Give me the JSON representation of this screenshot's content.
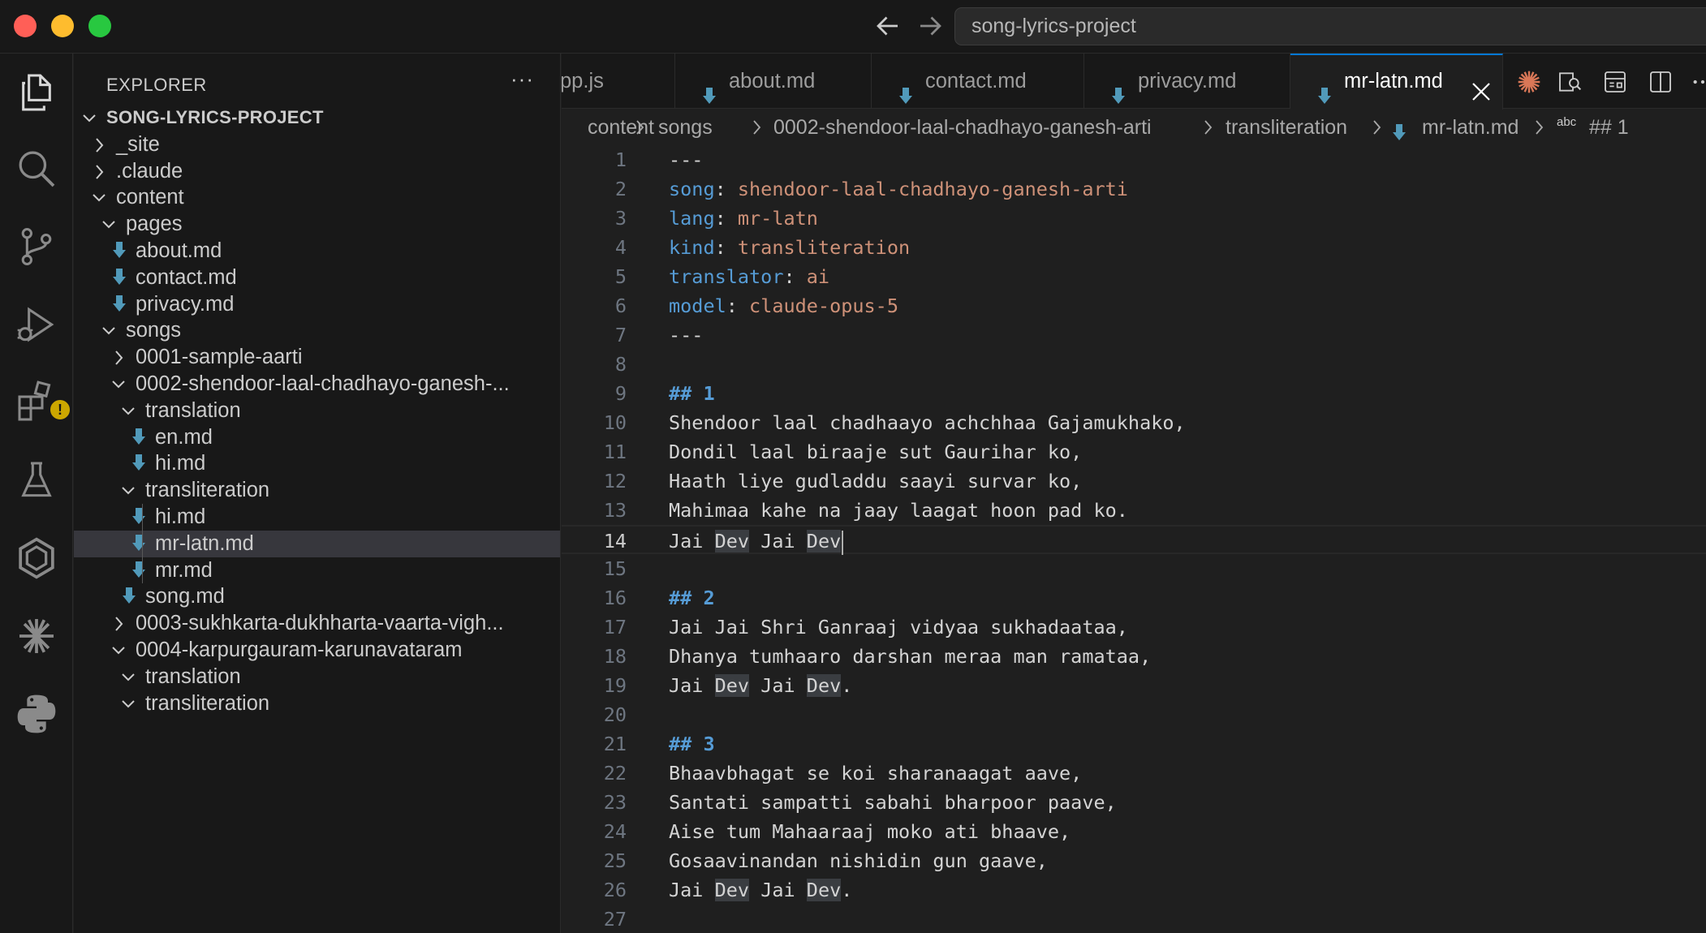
{
  "window": {
    "search_text": "song-lyrics-project"
  },
  "sidebar": {
    "title": "EXPLORER",
    "more": "···",
    "tree": [
      {
        "label": "SONG-LYRICS-PROJECT",
        "type": "root",
        "expanded": true,
        "depth": 0
      },
      {
        "label": "_site",
        "type": "folder",
        "expanded": false,
        "depth": 1
      },
      {
        "label": ".claude",
        "type": "folder",
        "expanded": false,
        "depth": 1
      },
      {
        "label": "content",
        "type": "folder",
        "expanded": true,
        "depth": 1
      },
      {
        "label": "pages",
        "type": "folder",
        "expanded": true,
        "depth": 2
      },
      {
        "label": "about.md",
        "type": "file",
        "depth": 3
      },
      {
        "label": "contact.md",
        "type": "file",
        "depth": 3
      },
      {
        "label": "privacy.md",
        "type": "file",
        "depth": 3
      },
      {
        "label": "songs",
        "type": "folder",
        "expanded": true,
        "depth": 2
      },
      {
        "label": "0001-sample-aarti",
        "type": "folder",
        "expanded": false,
        "depth": 3
      },
      {
        "label": "0002-shendoor-laal-chadhayo-ganesh-...",
        "type": "folder",
        "expanded": true,
        "depth": 3
      },
      {
        "label": "translation",
        "type": "folder",
        "expanded": true,
        "depth": 4
      },
      {
        "label": "en.md",
        "type": "file",
        "depth": 5
      },
      {
        "label": "hi.md",
        "type": "file",
        "depth": 5
      },
      {
        "label": "transliteration",
        "type": "folder",
        "expanded": true,
        "depth": 4
      },
      {
        "label": "hi.md",
        "type": "file",
        "depth": 5
      },
      {
        "label": "mr-latn.md",
        "type": "file",
        "depth": 5,
        "selected": true
      },
      {
        "label": "mr.md",
        "type": "file",
        "depth": 5
      },
      {
        "label": "song.md",
        "type": "file",
        "depth": 4
      },
      {
        "label": "0003-sukhkarta-dukhharta-vaarta-vigh...",
        "type": "folder",
        "expanded": false,
        "depth": 3
      },
      {
        "label": "0004-karpurgauram-karunavataram",
        "type": "folder",
        "expanded": true,
        "depth": 3
      },
      {
        "label": "translation",
        "type": "folder",
        "expanded": true,
        "depth": 4
      },
      {
        "label": "transliteration",
        "type": "folder",
        "expanded": true,
        "depth": 4
      }
    ]
  },
  "tabs": [
    {
      "label": "pp.js",
      "icon": false,
      "active": false
    },
    {
      "label": "about.md",
      "icon": true,
      "active": false
    },
    {
      "label": "contact.md",
      "icon": true,
      "active": false
    },
    {
      "label": "privacy.md",
      "icon": true,
      "active": false
    },
    {
      "label": "mr-latn.md",
      "icon": true,
      "active": true
    }
  ],
  "tab_actions": [
    "claude-icon",
    "open-preview-icon",
    "layout-icon",
    "split-editor-icon",
    "more-actions-icon"
  ],
  "breadcrumb": [
    "content",
    "songs",
    "0002-shendoor-laal-chadhayo-ganesh-arti",
    "transliteration",
    "mr-latn.md",
    "## 1"
  ],
  "breadcrumb_symbol_prefix": "abc",
  "editor": {
    "current_line": 14,
    "lines": [
      {
        "n": "1",
        "segs": [
          {
            "t": "---",
            "c": "p"
          }
        ]
      },
      {
        "n": "2",
        "segs": [
          {
            "t": "song",
            "c": "k"
          },
          {
            "t": ": ",
            "c": "p"
          },
          {
            "t": "shendoor-laal-chadhayo-ganesh-arti",
            "c": "v"
          }
        ]
      },
      {
        "n": "3",
        "segs": [
          {
            "t": "lang",
            "c": "k"
          },
          {
            "t": ": ",
            "c": "p"
          },
          {
            "t": "mr-latn",
            "c": "v"
          }
        ]
      },
      {
        "n": "4",
        "segs": [
          {
            "t": "kind",
            "c": "k"
          },
          {
            "t": ": ",
            "c": "p"
          },
          {
            "t": "transliteration",
            "c": "v"
          }
        ]
      },
      {
        "n": "5",
        "segs": [
          {
            "t": "translator",
            "c": "k"
          },
          {
            "t": ": ",
            "c": "p"
          },
          {
            "t": "ai",
            "c": "v"
          }
        ]
      },
      {
        "n": "6",
        "segs": [
          {
            "t": "model",
            "c": "k"
          },
          {
            "t": ": ",
            "c": "p"
          },
          {
            "t": "claude-opus-5",
            "c": "v"
          }
        ]
      },
      {
        "n": "7",
        "segs": [
          {
            "t": "---",
            "c": "p"
          }
        ]
      },
      {
        "n": "8",
        "segs": []
      },
      {
        "n": "9",
        "segs": [
          {
            "t": "## 1",
            "c": "h"
          }
        ]
      },
      {
        "n": "10",
        "segs": [
          {
            "t": "Shendoor laal chadhaayo achchhaa Gajamukhako,",
            "c": "p"
          }
        ]
      },
      {
        "n": "11",
        "segs": [
          {
            "t": "Dondil laal biraaje sut Gaurihar ko,",
            "c": "p"
          }
        ]
      },
      {
        "n": "12",
        "segs": [
          {
            "t": "Haath liye gudladdu saayi survar ko,",
            "c": "p"
          }
        ]
      },
      {
        "n": "13",
        "segs": [
          {
            "t": "Mahimaa kahe na jaay laagat hoon pad ko.",
            "c": "p"
          }
        ]
      },
      {
        "n": "14",
        "segs": [
          {
            "t": "Jai ",
            "c": "p"
          },
          {
            "t": "Dev",
            "c": "p hl"
          },
          {
            "t": " Jai ",
            "c": "p"
          },
          {
            "t": "Dev",
            "c": "p hl"
          }
        ],
        "caret": true
      },
      {
        "n": "15",
        "segs": []
      },
      {
        "n": "16",
        "segs": [
          {
            "t": "## 2",
            "c": "h"
          }
        ]
      },
      {
        "n": "17",
        "segs": [
          {
            "t": "Jai Jai Shri Ganraaj vidyaa sukhadaataa,",
            "c": "p"
          }
        ]
      },
      {
        "n": "18",
        "segs": [
          {
            "t": "Dhanya tumhaaro darshan meraa man ramataa,",
            "c": "p"
          }
        ]
      },
      {
        "n": "19",
        "segs": [
          {
            "t": "Jai ",
            "c": "p"
          },
          {
            "t": "Dev",
            "c": "p hl"
          },
          {
            "t": " Jai ",
            "c": "p"
          },
          {
            "t": "Dev",
            "c": "p hl"
          },
          {
            "t": ".",
            "c": "p"
          }
        ]
      },
      {
        "n": "20",
        "segs": []
      },
      {
        "n": "21",
        "segs": [
          {
            "t": "## 3",
            "c": "h"
          }
        ]
      },
      {
        "n": "22",
        "segs": [
          {
            "t": "Bhaavbhagat se koi sharanaagat aave,",
            "c": "p"
          }
        ]
      },
      {
        "n": "23",
        "segs": [
          {
            "t": "Santati sampatti sabahi bharpoor paave,",
            "c": "p"
          }
        ]
      },
      {
        "n": "24",
        "segs": [
          {
            "t": "Aise tum Mahaaraaj moko ati bhaave,",
            "c": "p"
          }
        ]
      },
      {
        "n": "25",
        "segs": [
          {
            "t": "Gosaavinandan nishidin gun gaave,",
            "c": "p"
          }
        ]
      },
      {
        "n": "26",
        "segs": [
          {
            "t": "Jai ",
            "c": "p"
          },
          {
            "t": "Dev",
            "c": "p hl"
          },
          {
            "t": " Jai ",
            "c": "p"
          },
          {
            "t": "Dev",
            "c": "p hl"
          },
          {
            "t": ".",
            "c": "p"
          }
        ]
      },
      {
        "n": "27",
        "segs": []
      }
    ]
  },
  "activity_bar": [
    "explorer-icon",
    "search-icon",
    "source-control-icon",
    "run-debug-icon",
    "extensions-icon",
    "testing-icon",
    "remote-explorer-icon",
    "claude-icon",
    "python-icon"
  ],
  "colors": {
    "accent": "#0078d4",
    "md_icon": "#519aba",
    "yaml_key": "#569cd6",
    "yaml_value": "#ce9178",
    "warning": "#cca700"
  }
}
